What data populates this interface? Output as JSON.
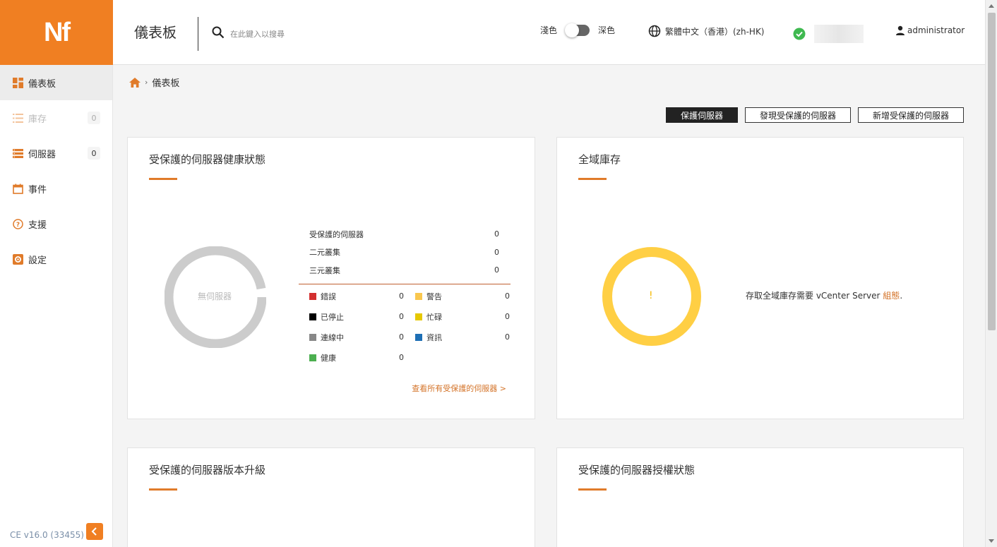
{
  "app": {
    "logo": "Nf"
  },
  "header": {
    "title": "儀表板",
    "search_placeholder": "在此鍵入以搜尋",
    "theme_light": "淺色",
    "theme_dark": "深色",
    "language": "繁體中文（香港）(zh-HK)",
    "user": "administrator"
  },
  "sidebar": {
    "items": [
      {
        "label": "儀表板",
        "icon": "dashboard-icon"
      },
      {
        "label": "庫存",
        "icon": "list-icon",
        "badge": "0"
      },
      {
        "label": "伺服器",
        "icon": "server-icon",
        "badge": "0"
      },
      {
        "label": "事件",
        "icon": "calendar-icon"
      },
      {
        "label": "支援",
        "icon": "help-icon"
      },
      {
        "label": "設定",
        "icon": "gear-icon"
      }
    ],
    "version": "CE v16.0 (33455)"
  },
  "breadcrumb": {
    "current": "儀表板"
  },
  "actions": {
    "protect": "保護伺服器",
    "discover": "發現受保護的伺服器",
    "add": "新增受保護的伺服器"
  },
  "health_card": {
    "title": "受保護的伺服器健康狀態",
    "donut_label": "無伺服器",
    "stats": [
      {
        "label": "受保護的伺服器",
        "value": "0"
      },
      {
        "label": "二元叢集",
        "value": "0"
      },
      {
        "label": "三元叢集",
        "value": "0"
      }
    ],
    "legend": [
      {
        "label": "錯誤",
        "value": "0",
        "color": "#d32f2f"
      },
      {
        "label": "警告",
        "value": "0",
        "color": "#f9c74f"
      },
      {
        "label": "已停止",
        "value": "0",
        "color": "#000000"
      },
      {
        "label": "忙碌",
        "value": "0",
        "color": "#e6c800"
      },
      {
        "label": "連線中",
        "value": "0",
        "color": "#888888"
      },
      {
        "label": "資訊",
        "value": "0",
        "color": "#1e6fb5"
      },
      {
        "label": "健康",
        "value": "0",
        "color": "#4caf50"
      }
    ],
    "view_all": "查看所有受保護的伺服器 >"
  },
  "global_card": {
    "title": "全域庫存",
    "donut_mark": "!",
    "msg_text": "存取全域庫存需要 vCenter Server ",
    "msg_link": "組態",
    "msg_end": "."
  },
  "upgrade_card": {
    "title": "受保護的伺服器版本升級"
  },
  "license_card": {
    "title": "受保護的伺服器授權狀態"
  },
  "colors": {
    "accent": "#f07f22",
    "donut_empty": "#cccccc",
    "donut_warn": "#ffcf44"
  }
}
